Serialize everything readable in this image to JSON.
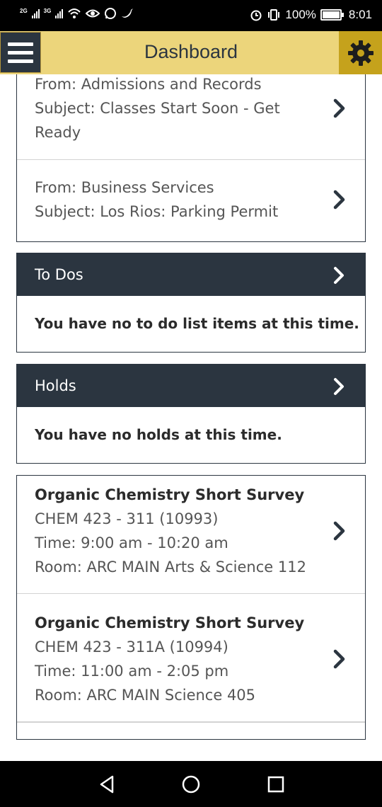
{
  "status_bar": {
    "network_2g": "2G",
    "network_3g": "3G",
    "battery_percent": "100%",
    "time": "8:01",
    "icons": [
      "signal-icon",
      "wifi-icon",
      "eye-icon",
      "whatsapp-icon",
      "twitter-icon",
      "alarm-icon",
      "vibrate-icon",
      "battery-icon"
    ]
  },
  "header": {
    "title": "Dashboard",
    "menu_icon": "hamburger-icon",
    "settings_icon": "gear-icon"
  },
  "messages": [
    {
      "from": "From: Admissions and Records",
      "subject_line1": "Subject: Classes Start Soon - Get",
      "subject_line2": "Ready"
    },
    {
      "from": "From: Business Services",
      "subject_line1": "Subject: Los Rios: Parking Permit"
    }
  ],
  "todos": {
    "title": "To Dos",
    "empty_text": "You have no to do list items at this time."
  },
  "holds": {
    "title": "Holds",
    "empty_text": "You have no holds at this time."
  },
  "classes": [
    {
      "name": "Organic Chemistry Short Survey",
      "code": "CHEM 423 - 311 (10993)",
      "time": "Time: 9:00 am - 10:20 am",
      "room": "Room: ARC MAIN Arts & Science 112"
    },
    {
      "name": "Organic Chemistry Short Survey",
      "code": "CHEM 423 - 311A (10994)",
      "time": "Time: 11:00 am - 2:05 pm",
      "room": "Room: ARC MAIN Science 405"
    }
  ],
  "colors": {
    "header_bg": "#ecd57b",
    "gear_bg": "#c5a21c",
    "dark": "#2b3540"
  }
}
